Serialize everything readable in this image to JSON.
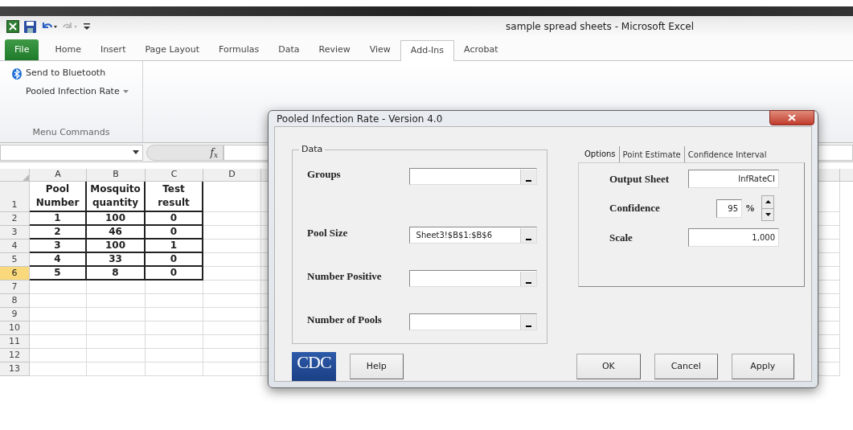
{
  "window": {
    "title": "sample spread sheets  -  Microsoft Excel"
  },
  "tabs": [
    {
      "label": "File",
      "kind": "file",
      "selected": false
    },
    {
      "label": "Home",
      "kind": "tab",
      "selected": false
    },
    {
      "label": "Insert",
      "kind": "tab",
      "selected": false
    },
    {
      "label": "Page Layout",
      "kind": "tab",
      "selected": false
    },
    {
      "label": "Formulas",
      "kind": "tab",
      "selected": false
    },
    {
      "label": "Data",
      "kind": "tab",
      "selected": false
    },
    {
      "label": "Review",
      "kind": "tab",
      "selected": false
    },
    {
      "label": "View",
      "kind": "tab",
      "selected": false
    },
    {
      "label": "Add-Ins",
      "kind": "tab",
      "selected": true
    },
    {
      "label": "Acrobat",
      "kind": "tab",
      "selected": false
    }
  ],
  "ribbon": {
    "commands": [
      {
        "label": "Send to Bluetooth",
        "kind": "icon"
      },
      {
        "label": "Pooled Infection Rate",
        "kind": "dropdown"
      }
    ],
    "group_label": "Menu Commands"
  },
  "formula_bar": {
    "function_label": "f$_{x}$"
  },
  "sheet": {
    "columns": [
      "A",
      "B",
      "C",
      "D"
    ],
    "rows": [
      {
        "header": "1",
        "selected": false,
        "cells": [
          "Pool Number",
          "Mosquito quantity",
          "Test result"
        ]
      },
      {
        "header": "2",
        "selected": false,
        "cells": [
          "1",
          "100",
          "0"
        ]
      },
      {
        "header": "3",
        "selected": false,
        "cells": [
          "2",
          "46",
          "0"
        ]
      },
      {
        "header": "4",
        "selected": false,
        "cells": [
          "3",
          "100",
          "1"
        ]
      },
      {
        "header": "5",
        "selected": false,
        "cells": [
          "4",
          "33",
          "0"
        ]
      },
      {
        "header": "6",
        "selected": true,
        "cells": [
          "5",
          "8",
          "0"
        ]
      },
      {
        "header": "7",
        "selected": false
      },
      {
        "header": "8",
        "selected": false
      },
      {
        "header": "9",
        "selected": false
      },
      {
        "header": "10",
        "selected": false
      },
      {
        "header": "11",
        "selected": false
      },
      {
        "header": "12",
        "selected": false
      },
      {
        "header": "13",
        "selected": false
      }
    ]
  },
  "dialog": {
    "title": "Pooled Infection Rate - Version 4.0",
    "data_group": {
      "legend": "Data",
      "fields": [
        {
          "label": "Groups"
        },
        {
          "label": "Pool Size",
          "value": "Sheet3!$B$1:$B$6"
        },
        {
          "label": "Number Positive"
        },
        {
          "label": "Number of Pools"
        }
      ]
    },
    "tabs": [
      {
        "label": "Options",
        "selected": true
      },
      {
        "label": "Point Estimate",
        "selected": false
      },
      {
        "label": "Confidence Interval",
        "selected": false
      }
    ],
    "options": {
      "output_sheet": {
        "label": "Output Sheet",
        "value": "InfRateCI"
      },
      "confidence": {
        "label": "Confidence",
        "value": "95",
        "unit": "%"
      },
      "scale": {
        "label": "Scale",
        "value": "1,000"
      }
    },
    "logo": "CDC",
    "buttons": [
      {
        "label": "Help",
        "kind": "help"
      },
      {
        "label": "OK",
        "kind": "action"
      },
      {
        "label": "Cancel",
        "kind": "action"
      },
      {
        "label": "Apply",
        "kind": "action"
      }
    ]
  }
}
